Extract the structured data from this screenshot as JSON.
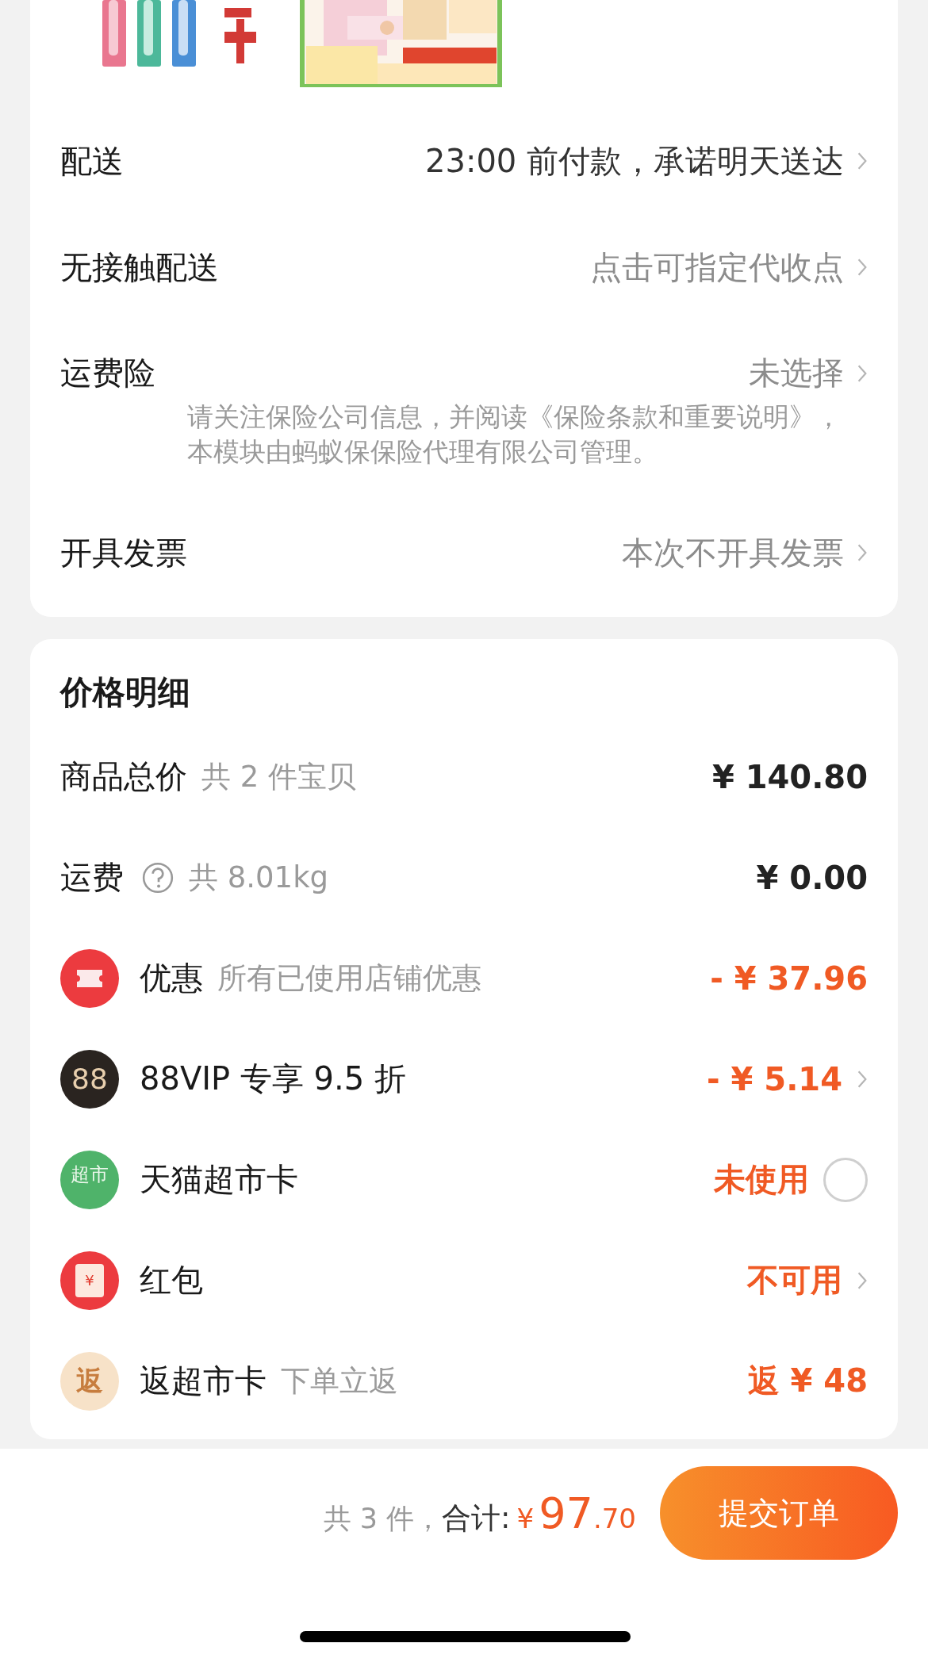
{
  "order_options": [
    {
      "label": "配送",
      "value": "23:00 前付款，承诺明天送达",
      "emphasis": true
    },
    {
      "label": "无接触配送",
      "value": "点击可指定代收点",
      "emphasis": false
    },
    {
      "label": "运费险",
      "value": "未选择",
      "emphasis": false,
      "note": "请关注保险公司信息，并阅读《保险条款和重要说明》，本模块由蚂蚁保保险代理有限公司管理。"
    },
    {
      "label": "开具发票",
      "value": "本次不开具发票",
      "emphasis": false
    }
  ],
  "price_details": {
    "title": "价格明细",
    "rows": [
      {
        "kind": "plain",
        "label": "商品总价",
        "sub": "共 2 件宝贝",
        "value": "¥ 140.80",
        "highlight": false,
        "arrow": false
      },
      {
        "kind": "help",
        "label": "运费",
        "sub": "共 8.01kg",
        "value": "¥ 0.00",
        "highlight": false,
        "arrow": false
      },
      {
        "kind": "coupon",
        "label": "优惠",
        "sub": "所有已使用店铺优惠",
        "value": "- ¥ 37.96",
        "highlight": true,
        "arrow": false
      },
      {
        "kind": "vip",
        "badge": "88",
        "label": "88VIP 专享 9.5 折",
        "value": "- ¥ 5.14",
        "highlight": true,
        "arrow": true
      },
      {
        "kind": "market",
        "badge": "超市",
        "label": "天猫超市卡",
        "value": "未使用",
        "highlight": true,
        "arrow": false,
        "checked": false
      },
      {
        "kind": "redpacket",
        "badge": "¥",
        "label": "红包",
        "value": "不可用",
        "highlight": true,
        "arrow": true
      },
      {
        "kind": "rebate",
        "badge": "返",
        "label": "返超市卡",
        "sub": "下单立返",
        "value": "返 ¥ 48",
        "highlight": true,
        "arrow": false
      }
    ]
  },
  "footer": {
    "count": "共 3 件，",
    "total_label": "合计:",
    "currency": "¥",
    "total_integer": "97",
    "total_decimal": ".70",
    "submit": "提交订单"
  }
}
